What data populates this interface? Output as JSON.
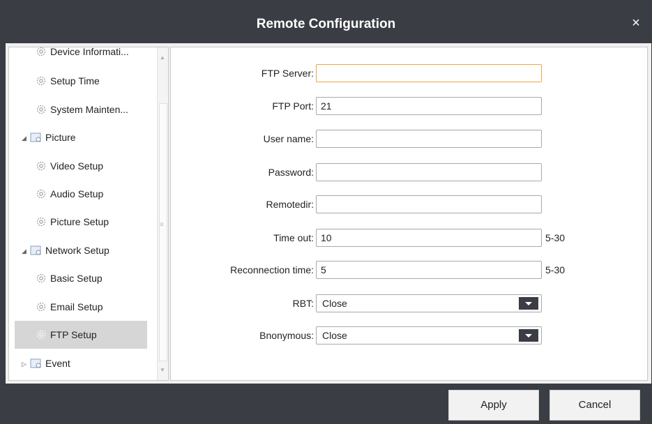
{
  "window": {
    "title": "Remote Configuration",
    "close_symbol": "×"
  },
  "sidebar": {
    "items": [
      {
        "label": "Device Informati...",
        "type": "child"
      },
      {
        "label": "Setup Time",
        "type": "child"
      },
      {
        "label": "System Mainten...",
        "type": "child"
      },
      {
        "label": "Picture",
        "type": "parent",
        "expanded": true
      },
      {
        "label": "Video Setup",
        "type": "child"
      },
      {
        "label": "Audio Setup",
        "type": "child"
      },
      {
        "label": "Picture Setup",
        "type": "child"
      },
      {
        "label": "Network Setup",
        "type": "parent",
        "expanded": true
      },
      {
        "label": "Basic Setup",
        "type": "child"
      },
      {
        "label": "Email Setup",
        "type": "child"
      },
      {
        "label": "FTP Setup",
        "type": "child",
        "selected": true
      },
      {
        "label": "Event",
        "type": "parent",
        "expanded": false
      }
    ]
  },
  "form": {
    "ftp_server": {
      "label": "FTP Server:",
      "value": ""
    },
    "ftp_port": {
      "label": "FTP Port:",
      "value": "21"
    },
    "user_name": {
      "label": "User name:",
      "value": ""
    },
    "password": {
      "label": "Password:",
      "value": ""
    },
    "remotedir": {
      "label": "Remotedir:",
      "value": ""
    },
    "time_out": {
      "label": "Time out:",
      "value": "10",
      "range": "5-30"
    },
    "reconnection_time": {
      "label": "Reconnection time:",
      "value": "5",
      "range": "5-30"
    },
    "rbt": {
      "label": "RBT:",
      "value": "Close"
    },
    "bnonymous": {
      "label": "Bnonymous:",
      "value": "Close"
    }
  },
  "footer": {
    "apply_label": "Apply",
    "cancel_label": "Cancel"
  },
  "colors": {
    "chrome": "#3a3d44",
    "focus_border": "#f0a544",
    "selected_row": "#d6d6d6"
  }
}
